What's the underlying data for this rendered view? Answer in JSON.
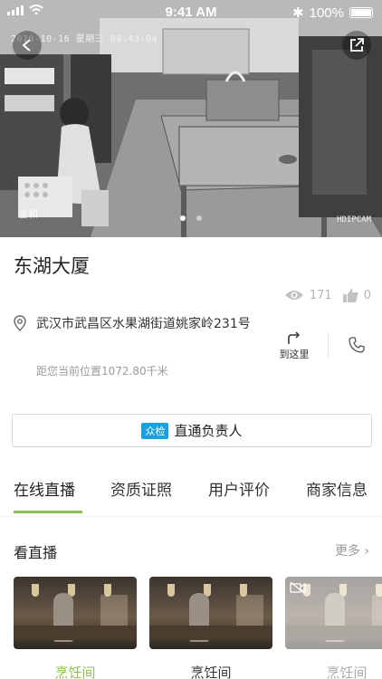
{
  "status_bar": {
    "time": "9:41 AM",
    "battery": "100%"
  },
  "camera": {
    "timestamp": "2019-10-16 星期三 09:43:04",
    "tag": "HDIPCAM",
    "watermark": "金和"
  },
  "store": {
    "name": "东湖大厦",
    "views": "171",
    "likes": "0",
    "address": "武汉市武昌区水果湖街道姚家岭231号",
    "distance": "距您当前位置1072.80千米",
    "navigate_label": "到这里"
  },
  "contact": {
    "badge": "众检",
    "label": "直通负责人"
  },
  "tabs": [
    {
      "label": "在线直播"
    },
    {
      "label": "资质证照"
    },
    {
      "label": "用户评价"
    },
    {
      "label": "商家信息"
    }
  ],
  "live": {
    "title": "看直播",
    "more": "更多",
    "items": [
      {
        "label": "烹饪间"
      },
      {
        "label": "烹饪间"
      },
      {
        "label": "烹饪间"
      }
    ]
  },
  "colors": {
    "accent": "#8cc152",
    "badge": "#1aa0e0"
  }
}
